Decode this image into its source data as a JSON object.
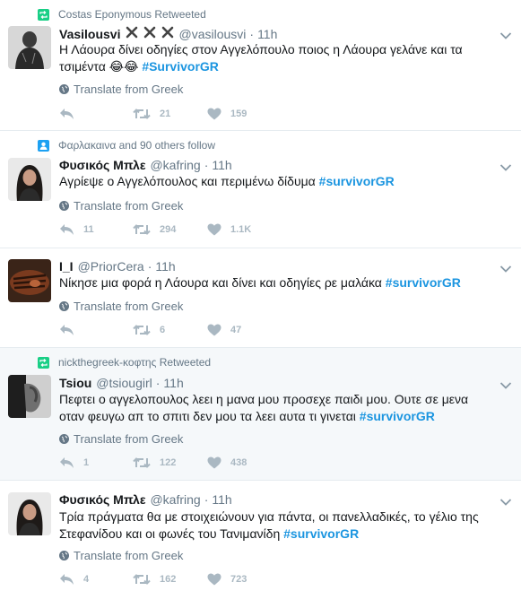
{
  "colors": {
    "link": "#1b95e0",
    "muted": "#657786",
    "icon": "#aab8c2",
    "retweet_context": "#19cf86",
    "follow_context": "#1da1f2"
  },
  "tweets": [
    {
      "context_type": "retweet",
      "context_text": "Costas Eponymous Retweeted",
      "name": "Vasilousvi",
      "handle": "@vasilousvi",
      "dot": "·",
      "time": "11h",
      "badges": [
        "✕",
        "✕",
        "✕"
      ],
      "text": "Η Λάουρα δίνει οδηγίες στον Αγγελόπουλο ποιος η Λάουρα γελάνε και τα τσιμέντα 😂😂 ",
      "hashtag": "#SurvivorGR",
      "translate": "Translate from Greek",
      "replies": "",
      "retweets": "21",
      "likes": "159"
    },
    {
      "context_type": "follow",
      "context_text": "Φαρλακαινα and 90 others follow",
      "name": "Φυσικός Μπλε",
      "handle": "@kafring",
      "dot": "·",
      "time": "11h",
      "text": "Αγρίεψε ο Αγγελόπουλος και περιμένω δίδυμα ",
      "hashtag": "#survivorGR",
      "translate": "Translate from Greek",
      "replies": "11",
      "retweets": "294",
      "likes": "1.1K"
    },
    {
      "context_type": "",
      "name": "I_I",
      "handle": "@PriorCera",
      "dot": "·",
      "time": "11h",
      "text": "Νίκησε μια φορά η Λάουρα και δίνει και οδηγίες ρε μαλάκα ",
      "hashtag": "#survivorGR",
      "translate": "Translate from Greek",
      "replies": "",
      "retweets": "6",
      "likes": "47"
    },
    {
      "context_type": "retweet",
      "context_text": "nickthegreek-κοφτης Retweeted",
      "name": "Tsiou",
      "handle": "@tsiougirl",
      "dot": "·",
      "time": "11h",
      "text": "Πεφτει ο αγγελοπουλος λεει η μανα μου προσεχε παιδι μου. Ουτε σε μενα οταν φευγω απ το σπιτι δεν μου τα λεει αυτα τι γινεται ",
      "hashtag": "#survivorGR",
      "translate": "Translate from Greek",
      "replies": "1",
      "retweets": "122",
      "likes": "438"
    },
    {
      "context_type": "",
      "name": "Φυσικός Μπλε",
      "handle": "@kafring",
      "dot": "·",
      "time": "11h",
      "text": "Τρία πράγματα θα με στοιχειώνουν για πάντα, οι πανελλαδικές, το γέλιο της Στεφανίδου και οι φωνές του Τανιμανίδη ",
      "hashtag": "#survivorGR",
      "translate": "Translate from Greek",
      "replies": "4",
      "retweets": "162",
      "likes": "723"
    }
  ]
}
